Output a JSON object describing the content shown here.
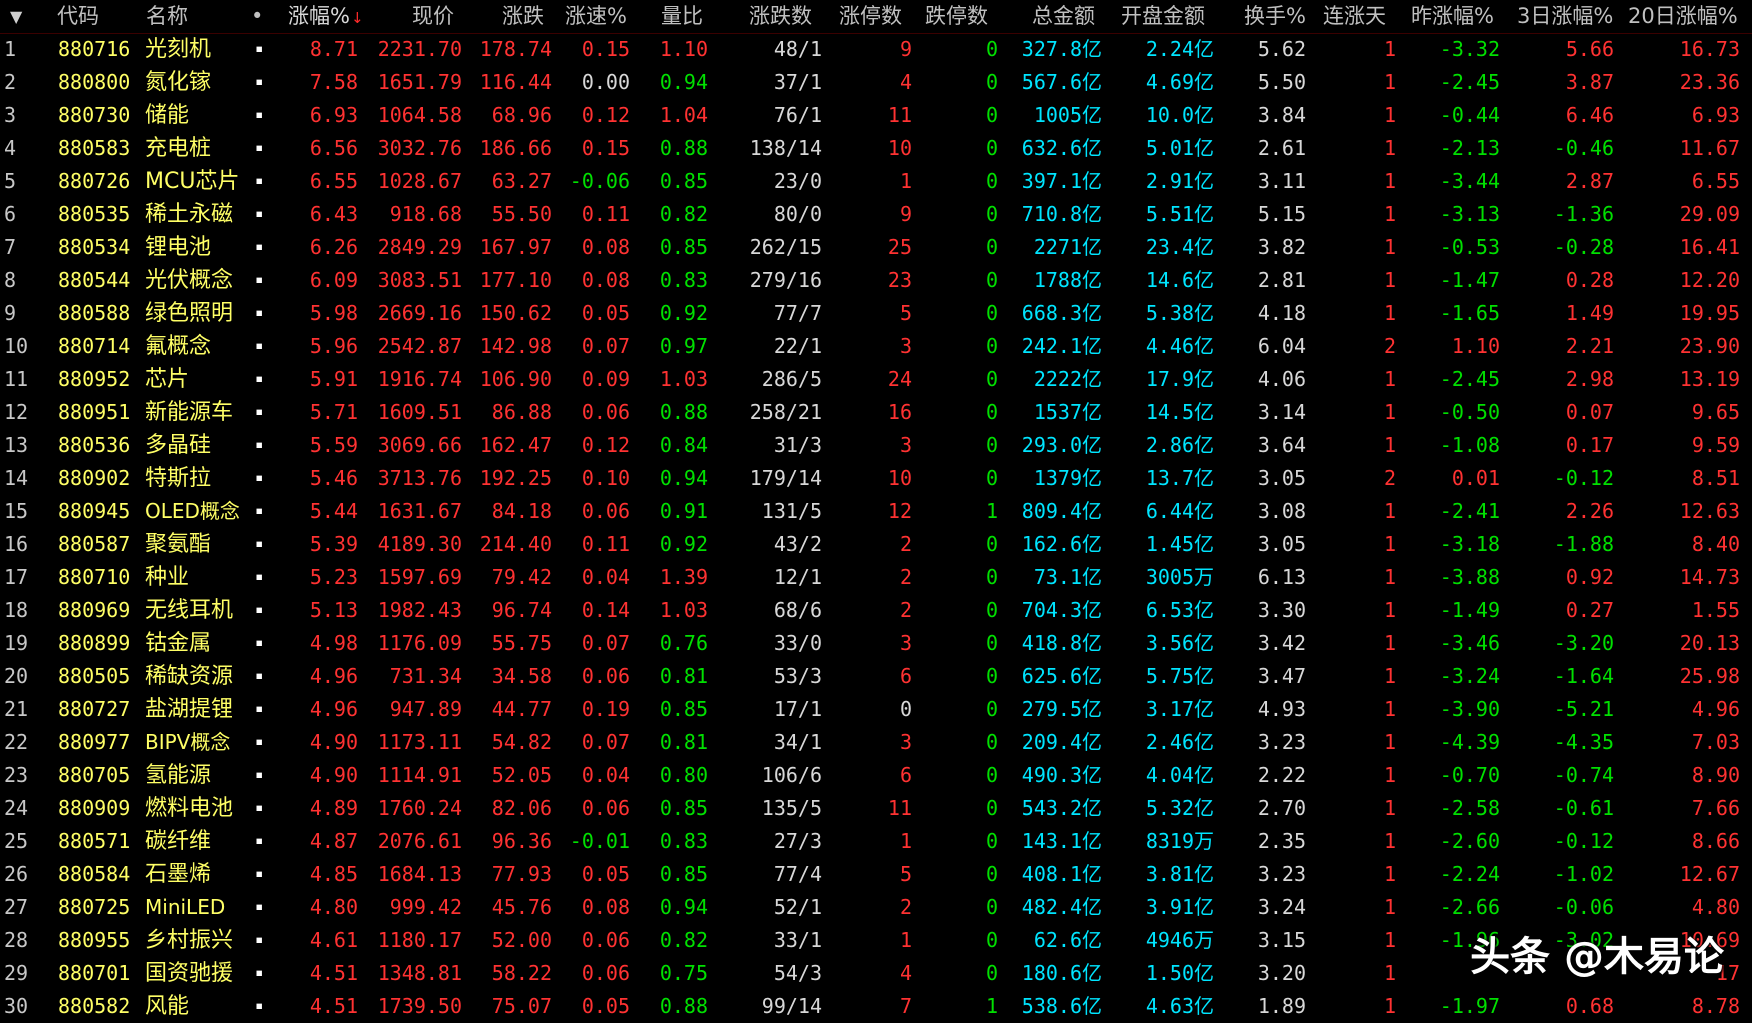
{
  "watermark": "头条 @木易论",
  "colors": {
    "up": "#ff3232",
    "down": "#00e000",
    "flat": "#d8d8d8",
    "code": "#ffff66",
    "amount": "#00e5ff"
  },
  "icons": {
    "menu": "triangle-down-icon",
    "sort": "arrow-down-icon",
    "row_marker": "square-dot-icon"
  },
  "header": {
    "menu_arrow": "▼",
    "code": "代码",
    "name": "名称",
    "dot": "•",
    "pct": "涨幅%",
    "sort_arrow": "↓",
    "price": "现价",
    "chg": "涨跌",
    "speed": "涨速%",
    "vr": "量比",
    "adv": "涨跌数",
    "limup": "涨停数",
    "limdn": "跌停数",
    "amount": "总金额",
    "open_amt": "开盘金额",
    "turnover": "换手%",
    "streak": "连涨天",
    "yday": "昨涨幅%",
    "d3": "3日涨幅%",
    "d20": "20日涨幅%"
  },
  "rows": [
    {
      "i": "1",
      "code": "880716",
      "name": "光刻机",
      "dot": "▪",
      "pct": "8.71",
      "price": "2231.70",
      "chg": "178.74",
      "speed": "0.15",
      "vr": "1.10",
      "adv": "48/1",
      "limup": "9",
      "limdn": "0",
      "amount": "327.8亿",
      "open_amt": "2.24亿",
      "turnover": "5.62",
      "streak": "1",
      "yday": "-3.32",
      "d3": "5.66",
      "d20": "16.73"
    },
    {
      "i": "2",
      "code": "880800",
      "name": "氮化镓",
      "dot": "▪",
      "pct": "7.58",
      "price": "1651.79",
      "chg": "116.44",
      "speed": "0.00",
      "vr": "0.94",
      "adv": "37/1",
      "limup": "4",
      "limdn": "0",
      "amount": "567.6亿",
      "open_amt": "4.69亿",
      "turnover": "5.50",
      "streak": "1",
      "yday": "-2.45",
      "d3": "3.87",
      "d20": "23.36"
    },
    {
      "i": "3",
      "code": "880730",
      "name": "储能",
      "dot": "▪",
      "pct": "6.93",
      "price": "1064.58",
      "chg": "68.96",
      "speed": "0.12",
      "vr": "1.04",
      "adv": "76/1",
      "limup": "11",
      "limdn": "0",
      "amount": "1005亿",
      "open_amt": "10.0亿",
      "turnover": "3.84",
      "streak": "1",
      "yday": "-0.44",
      "d3": "6.46",
      "d20": "6.93"
    },
    {
      "i": "4",
      "code": "880583",
      "name": "充电桩",
      "dot": "▪",
      "pct": "6.56",
      "price": "3032.76",
      "chg": "186.66",
      "speed": "0.15",
      "vr": "0.88",
      "adv": "138/14",
      "limup": "10",
      "limdn": "0",
      "amount": "632.6亿",
      "open_amt": "5.01亿",
      "turnover": "2.61",
      "streak": "1",
      "yday": "-2.13",
      "d3": "-0.46",
      "d20": "11.67"
    },
    {
      "i": "5",
      "code": "880726",
      "name": "MCU芯片",
      "dot": "▪",
      "pct": "6.55",
      "price": "1028.67",
      "chg": "63.27",
      "speed": "-0.06",
      "vr": "0.85",
      "adv": "23/0",
      "limup": "1",
      "limdn": "0",
      "amount": "397.1亿",
      "open_amt": "2.91亿",
      "turnover": "3.11",
      "streak": "1",
      "yday": "-3.44",
      "d3": "2.87",
      "d20": "6.55"
    },
    {
      "i": "6",
      "code": "880535",
      "name": "稀土永磁",
      "dot": "▪",
      "pct": "6.43",
      "price": "918.68",
      "chg": "55.50",
      "speed": "0.11",
      "vr": "0.82",
      "adv": "80/0",
      "limup": "9",
      "limdn": "0",
      "amount": "710.8亿",
      "open_amt": "5.51亿",
      "turnover": "5.15",
      "streak": "1",
      "yday": "-3.13",
      "d3": "-1.36",
      "d20": "29.09"
    },
    {
      "i": "7",
      "code": "880534",
      "name": "锂电池",
      "dot": "▪",
      "pct": "6.26",
      "price": "2849.29",
      "chg": "167.97",
      "speed": "0.08",
      "vr": "0.85",
      "adv": "262/15",
      "limup": "25",
      "limdn": "0",
      "amount": "2271亿",
      "open_amt": "23.4亿",
      "turnover": "3.82",
      "streak": "1",
      "yday": "-0.53",
      "d3": "-0.28",
      "d20": "16.41"
    },
    {
      "i": "8",
      "code": "880544",
      "name": "光伏概念",
      "dot": "▪",
      "pct": "6.09",
      "price": "3083.51",
      "chg": "177.10",
      "speed": "0.08",
      "vr": "0.83",
      "adv": "279/16",
      "limup": "23",
      "limdn": "0",
      "amount": "1788亿",
      "open_amt": "14.6亿",
      "turnover": "2.81",
      "streak": "1",
      "yday": "-1.47",
      "d3": "0.28",
      "d20": "12.20"
    },
    {
      "i": "9",
      "code": "880588",
      "name": "绿色照明",
      "dot": "▪",
      "pct": "5.98",
      "price": "2669.16",
      "chg": "150.62",
      "speed": "0.05",
      "vr": "0.92",
      "adv": "77/7",
      "limup": "5",
      "limdn": "0",
      "amount": "668.3亿",
      "open_amt": "5.38亿",
      "turnover": "4.18",
      "streak": "1",
      "yday": "-1.65",
      "d3": "1.49",
      "d20": "19.95"
    },
    {
      "i": "10",
      "code": "880714",
      "name": "氟概念",
      "dot": "▪",
      "pct": "5.96",
      "price": "2542.87",
      "chg": "142.98",
      "speed": "0.07",
      "vr": "0.97",
      "adv": "22/1",
      "limup": "3",
      "limdn": "0",
      "amount": "242.1亿",
      "open_amt": "4.46亿",
      "turnover": "6.04",
      "streak": "2",
      "yday": "1.10",
      "d3": "2.21",
      "d20": "23.90"
    },
    {
      "i": "11",
      "code": "880952",
      "name": "芯片",
      "dot": "▪",
      "pct": "5.91",
      "price": "1916.74",
      "chg": "106.90",
      "speed": "0.09",
      "vr": "1.03",
      "adv": "286/5",
      "limup": "24",
      "limdn": "0",
      "amount": "2222亿",
      "open_amt": "17.9亿",
      "turnover": "4.06",
      "streak": "1",
      "yday": "-2.45",
      "d3": "2.98",
      "d20": "13.19"
    },
    {
      "i": "12",
      "code": "880951",
      "name": "新能源车",
      "dot": "▪",
      "pct": "5.71",
      "price": "1609.51",
      "chg": "86.88",
      "speed": "0.06",
      "vr": "0.88",
      "adv": "258/21",
      "limup": "16",
      "limdn": "0",
      "amount": "1537亿",
      "open_amt": "14.5亿",
      "turnover": "3.14",
      "streak": "1",
      "yday": "-0.50",
      "d3": "0.07",
      "d20": "9.65"
    },
    {
      "i": "13",
      "code": "880536",
      "name": "多晶硅",
      "dot": "▪",
      "pct": "5.59",
      "price": "3069.66",
      "chg": "162.47",
      "speed": "0.12",
      "vr": "0.84",
      "adv": "31/3",
      "limup": "3",
      "limdn": "0",
      "amount": "293.0亿",
      "open_amt": "2.86亿",
      "turnover": "3.64",
      "streak": "1",
      "yday": "-1.08",
      "d3": "0.17",
      "d20": "9.59"
    },
    {
      "i": "14",
      "code": "880902",
      "name": "特斯拉",
      "dot": "▪",
      "pct": "5.46",
      "price": "3713.76",
      "chg": "192.25",
      "speed": "0.10",
      "vr": "0.94",
      "adv": "179/14",
      "limup": "10",
      "limdn": "0",
      "amount": "1379亿",
      "open_amt": "13.7亿",
      "turnover": "3.05",
      "streak": "2",
      "yday": "0.01",
      "d3": "-0.12",
      "d20": "8.51"
    },
    {
      "i": "15",
      "code": "880945",
      "name": "OLED概念",
      "dot": "▪",
      "pct": "5.44",
      "price": "1631.67",
      "chg": "84.18",
      "speed": "0.06",
      "vr": "0.91",
      "adv": "131/5",
      "limup": "12",
      "limdn": "1",
      "amount": "809.4亿",
      "open_amt": "6.44亿",
      "turnover": "3.08",
      "streak": "1",
      "yday": "-2.41",
      "d3": "2.26",
      "d20": "12.63"
    },
    {
      "i": "16",
      "code": "880587",
      "name": "聚氨酯",
      "dot": "▪",
      "pct": "5.39",
      "price": "4189.30",
      "chg": "214.40",
      "speed": "0.11",
      "vr": "0.92",
      "adv": "43/2",
      "limup": "2",
      "limdn": "0",
      "amount": "162.6亿",
      "open_amt": "1.45亿",
      "turnover": "3.05",
      "streak": "1",
      "yday": "-3.18",
      "d3": "-1.88",
      "d20": "8.40"
    },
    {
      "i": "17",
      "code": "880710",
      "name": "种业",
      "dot": "▪",
      "pct": "5.23",
      "price": "1597.69",
      "chg": "79.42",
      "speed": "0.04",
      "vr": "1.39",
      "adv": "12/1",
      "limup": "2",
      "limdn": "0",
      "amount": "73.1亿",
      "open_amt": "3005万",
      "turnover": "6.13",
      "streak": "1",
      "yday": "-3.88",
      "d3": "0.92",
      "d20": "14.73"
    },
    {
      "i": "18",
      "code": "880969",
      "name": "无线耳机",
      "dot": "▪",
      "pct": "5.13",
      "price": "1982.43",
      "chg": "96.74",
      "speed": "0.14",
      "vr": "1.03",
      "adv": "68/6",
      "limup": "2",
      "limdn": "0",
      "amount": "704.3亿",
      "open_amt": "6.53亿",
      "turnover": "3.30",
      "streak": "1",
      "yday": "-1.49",
      "d3": "0.27",
      "d20": "1.55"
    },
    {
      "i": "19",
      "code": "880899",
      "name": "钴金属",
      "dot": "▪",
      "pct": "4.98",
      "price": "1176.09",
      "chg": "55.75",
      "speed": "0.07",
      "vr": "0.76",
      "adv": "33/0",
      "limup": "3",
      "limdn": "0",
      "amount": "418.8亿",
      "open_amt": "3.56亿",
      "turnover": "3.42",
      "streak": "1",
      "yday": "-3.46",
      "d3": "-3.20",
      "d20": "20.13"
    },
    {
      "i": "20",
      "code": "880505",
      "name": "稀缺资源",
      "dot": "▪",
      "pct": "4.96",
      "price": "731.34",
      "chg": "34.58",
      "speed": "0.06",
      "vr": "0.81",
      "adv": "53/3",
      "limup": "6",
      "limdn": "0",
      "amount": "625.6亿",
      "open_amt": "5.75亿",
      "turnover": "3.47",
      "streak": "1",
      "yday": "-3.24",
      "d3": "-1.64",
      "d20": "25.98"
    },
    {
      "i": "21",
      "code": "880727",
      "name": "盐湖提锂",
      "dot": "▪",
      "pct": "4.96",
      "price": "947.89",
      "chg": "44.77",
      "speed": "0.19",
      "vr": "0.85",
      "adv": "17/1",
      "limup": "0",
      "limdn": "0",
      "amount": "279.5亿",
      "open_amt": "3.17亿",
      "turnover": "4.93",
      "streak": "1",
      "yday": "-3.90",
      "d3": "-5.21",
      "d20": "4.96"
    },
    {
      "i": "22",
      "code": "880977",
      "name": "BIPV概念",
      "dot": "▪",
      "pct": "4.90",
      "price": "1173.11",
      "chg": "54.82",
      "speed": "0.07",
      "vr": "0.81",
      "adv": "34/1",
      "limup": "3",
      "limdn": "0",
      "amount": "209.4亿",
      "open_amt": "2.46亿",
      "turnover": "3.23",
      "streak": "1",
      "yday": "-4.39",
      "d3": "-4.35",
      "d20": "7.03"
    },
    {
      "i": "23",
      "code": "880705",
      "name": "氢能源",
      "dot": "▪",
      "pct": "4.90",
      "price": "1114.91",
      "chg": "52.05",
      "speed": "0.04",
      "vr": "0.80",
      "adv": "106/6",
      "limup": "6",
      "limdn": "0",
      "amount": "490.3亿",
      "open_amt": "4.04亿",
      "turnover": "2.22",
      "streak": "1",
      "yday": "-0.70",
      "d3": "-0.74",
      "d20": "8.90"
    },
    {
      "i": "24",
      "code": "880909",
      "name": "燃料电池",
      "dot": "▪",
      "pct": "4.89",
      "price": "1760.24",
      "chg": "82.06",
      "speed": "0.06",
      "vr": "0.85",
      "adv": "135/5",
      "limup": "11",
      "limdn": "0",
      "amount": "543.2亿",
      "open_amt": "5.32亿",
      "turnover": "2.70",
      "streak": "1",
      "yday": "-2.58",
      "d3": "-0.61",
      "d20": "7.66"
    },
    {
      "i": "25",
      "code": "880571",
      "name": "碳纤维",
      "dot": "▪",
      "pct": "4.87",
      "price": "2076.61",
      "chg": "96.36",
      "speed": "-0.01",
      "vr": "0.83",
      "adv": "27/3",
      "limup": "1",
      "limdn": "0",
      "amount": "143.1亿",
      "open_amt": "8319万",
      "turnover": "2.35",
      "streak": "1",
      "yday": "-2.60",
      "d3": "-0.12",
      "d20": "8.66"
    },
    {
      "i": "26",
      "code": "880584",
      "name": "石墨烯",
      "dot": "▪",
      "pct": "4.85",
      "price": "1684.13",
      "chg": "77.93",
      "speed": "0.05",
      "vr": "0.85",
      "adv": "77/4",
      "limup": "5",
      "limdn": "0",
      "amount": "408.1亿",
      "open_amt": "3.81亿",
      "turnover": "3.23",
      "streak": "1",
      "yday": "-2.24",
      "d3": "-1.02",
      "d20": "12.67"
    },
    {
      "i": "27",
      "code": "880725",
      "name": "MiniLED",
      "dot": "▪",
      "pct": "4.80",
      "price": "999.42",
      "chg": "45.76",
      "speed": "0.08",
      "vr": "0.94",
      "adv": "52/1",
      "limup": "2",
      "limdn": "0",
      "amount": "482.4亿",
      "open_amt": "3.91亿",
      "turnover": "3.24",
      "streak": "1",
      "yday": "-2.66",
      "d3": "-0.06",
      "d20": "4.80"
    },
    {
      "i": "28",
      "code": "880955",
      "name": "乡村振兴",
      "dot": "▪",
      "pct": "4.61",
      "price": "1180.17",
      "chg": "52.00",
      "speed": "0.06",
      "vr": "0.82",
      "adv": "33/1",
      "limup": "1",
      "limdn": "0",
      "amount": "62.6亿",
      "open_amt": "4946万",
      "turnover": "3.15",
      "streak": "1",
      "yday": "-1.96",
      "d3": "-3.02",
      "d20": "10.69"
    },
    {
      "i": "29",
      "code": "880701",
      "name": "国资驰援",
      "dot": "▪",
      "pct": "4.51",
      "price": "1348.81",
      "chg": "58.22",
      "speed": "0.06",
      "vr": "0.75",
      "adv": "54/3",
      "limup": "4",
      "limdn": "0",
      "amount": "180.6亿",
      "open_amt": "1.50亿",
      "turnover": "3.20",
      "streak": "1",
      "yday": "",
      "d3": "",
      "d20": "17"
    },
    {
      "i": "30",
      "code": "880582",
      "name": "风能",
      "dot": "▪",
      "pct": "4.51",
      "price": "1739.50",
      "chg": "75.07",
      "speed": "0.05",
      "vr": "0.88",
      "adv": "99/14",
      "limup": "7",
      "limdn": "1",
      "amount": "538.6亿",
      "open_amt": "4.63亿",
      "turnover": "1.89",
      "streak": "1",
      "yday": "-1.97",
      "d3": "0.68",
      "d20": "8.78"
    }
  ]
}
